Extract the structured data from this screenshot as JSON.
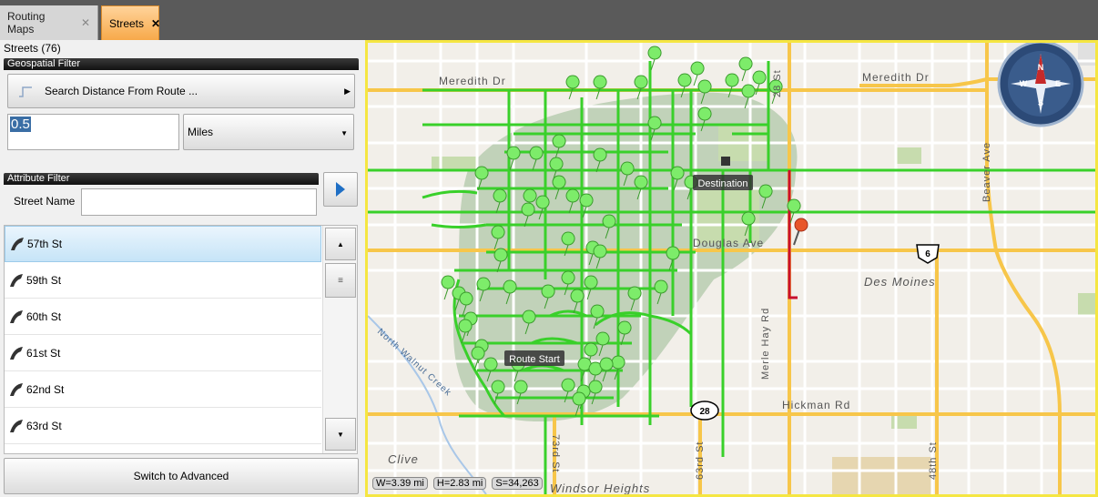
{
  "tabs": [
    {
      "label": "Routing Maps",
      "close": "✕"
    },
    {
      "label": "Streets",
      "close": "✕"
    }
  ],
  "left_panel": {
    "streets_count": "Streets (76)",
    "geospatial_header": "Geospatial Filter",
    "search_button": "Search  Distance From Route ...",
    "distance_value": "0.5",
    "units_selected": "Miles",
    "attribute_header": "Attribute Filter",
    "street_name_label": "Street Name",
    "street_name_value": "",
    "streets": [
      "57th St",
      "59th St",
      "60th St",
      "61st St",
      "62nd St",
      "63rd St"
    ],
    "selected_street": "57th St",
    "switch_button": "Switch to Advanced"
  },
  "map": {
    "labels": {
      "meredith_left": "Meredith Dr",
      "meredith_right": "Meredith Dr",
      "beaver": "Beaver Ave",
      "douglas": "Douglas Ave",
      "des_moines": "Des Moines",
      "merle_hay": "Merle Hay Rd",
      "hickman": "Hickman Rd",
      "clive": "Clive",
      "windsor": "Windsor Heights",
      "north_walnut": "North Walnut Creek",
      "st73": "73rd St",
      "st63": "63rd St",
      "st48": "48th St",
      "st28": "28 St",
      "hwy6": "6",
      "hwy28": "28"
    },
    "callouts": {
      "destination": "Destination",
      "route_start": "Route Start"
    },
    "readouts": {
      "width": "W=3.39 mi",
      "height": "H=2.83 mi",
      "scale": "S=34,263"
    },
    "colors": {
      "street_highlight": "#39d02a",
      "route": "#c8102e",
      "major_road": "#f7c64a",
      "buffer": "#8fb58a"
    }
  }
}
